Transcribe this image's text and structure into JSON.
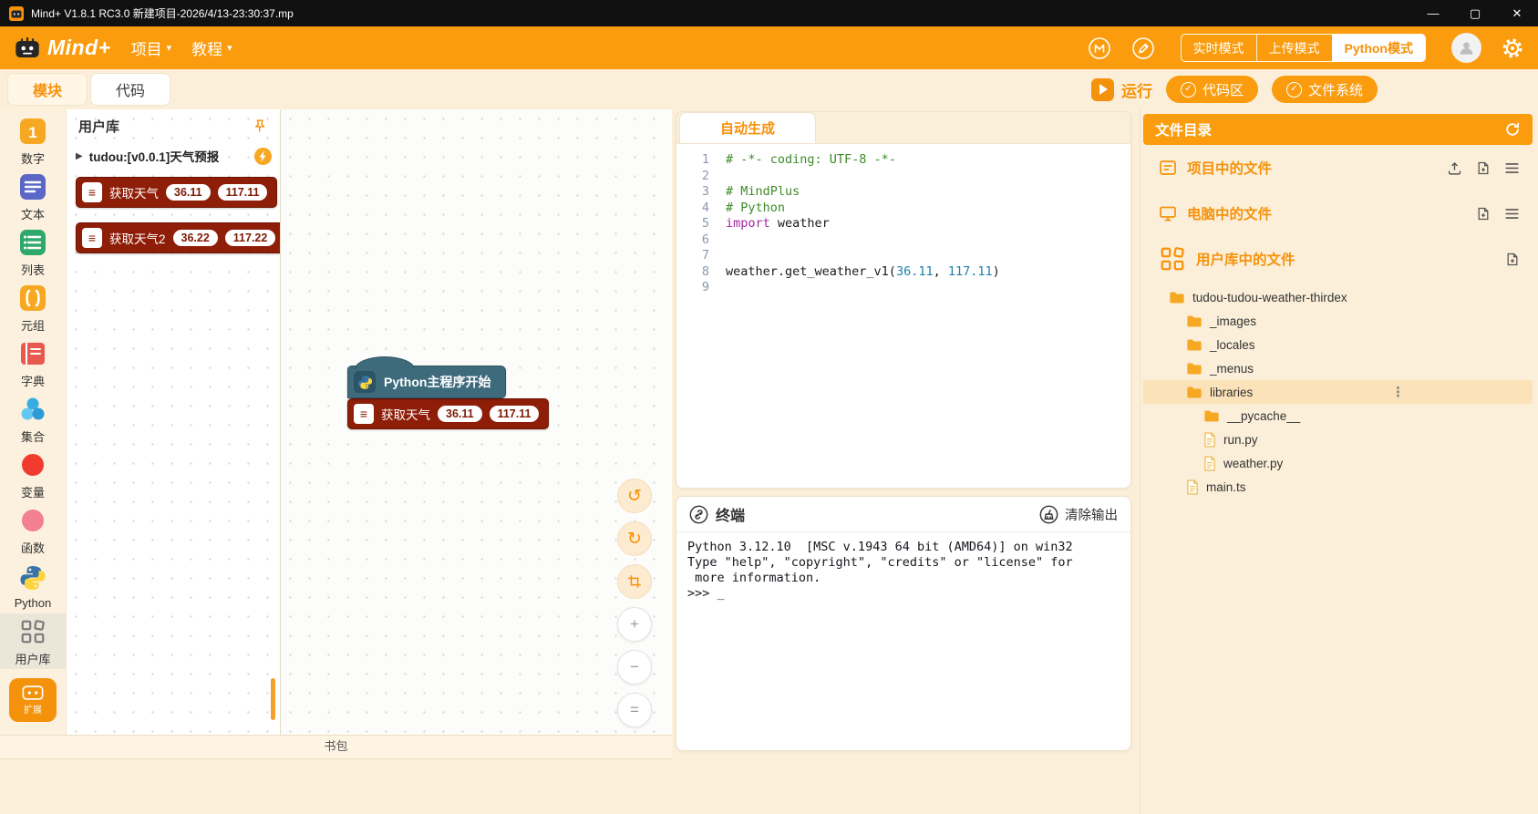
{
  "colors": {
    "accent": "#FA9C0D",
    "accent_text": "#F5920B",
    "block_red": "#8E1E08",
    "hat_blue": "#3E6B7C"
  },
  "titlebar": {
    "title": "Mind+ V1.8.1 RC3.0  新建项目-2026/4/13-23:30:37.mp",
    "minimize": "—",
    "maximize": "▢",
    "close": "✕"
  },
  "header": {
    "logo_text": "Mind+",
    "menus": [
      {
        "label": "项目"
      },
      {
        "label": "教程"
      }
    ],
    "modes": {
      "items": [
        "实时模式",
        "上传模式",
        "Python模式"
      ],
      "active": "Python模式"
    }
  },
  "toolbar": {
    "tabs": [
      {
        "label": "模块",
        "active": true
      },
      {
        "label": "代码",
        "active": false
      }
    ],
    "run_label": "运行",
    "code_area_label": "代码区",
    "file_system_label": "文件系统"
  },
  "sidebar": {
    "items": [
      {
        "label": "数字",
        "icon": "num"
      },
      {
        "label": "文本",
        "icon": "text"
      },
      {
        "label": "列表",
        "icon": "list"
      },
      {
        "label": "元组",
        "icon": "tuple"
      },
      {
        "label": "字典",
        "icon": "dict"
      },
      {
        "label": "集合",
        "icon": "set"
      },
      {
        "label": "变量",
        "icon": "var"
      },
      {
        "label": "函数",
        "icon": "fn"
      },
      {
        "label": "Python",
        "icon": "python"
      },
      {
        "label": "用户库",
        "icon": "userlib",
        "active": true
      }
    ],
    "extension_label": "扩展"
  },
  "palette": {
    "title": "用户库",
    "group": {
      "label": "tudou:[v0.0.1]天气预报"
    },
    "blocks": [
      {
        "label": "获取天气",
        "args": [
          "36.11",
          "117.11"
        ]
      },
      {
        "label": "获取天气2",
        "args": [
          "36.22",
          "117.22"
        ]
      }
    ]
  },
  "canvas": {
    "hat_label": "Python主程序开始",
    "blocks": [
      {
        "label": "获取天气",
        "args": [
          "36.11",
          "117.11"
        ]
      }
    ],
    "backpack_label": "书包"
  },
  "code": {
    "tab": "自动生成",
    "lines": [
      [
        {
          "t": "# -*- coding: UTF-8 -*-",
          "c": "comment"
        }
      ],
      [],
      [
        {
          "t": "# MindPlus",
          "c": "comment"
        }
      ],
      [
        {
          "t": "# Python",
          "c": "comment"
        }
      ],
      [
        {
          "t": "import",
          "c": "keyword"
        },
        {
          "t": " weather",
          "c": "plain"
        }
      ],
      [],
      [],
      [
        {
          "t": "weather.get_weather_v1(",
          "c": "plain"
        },
        {
          "t": "36.11",
          "c": "number"
        },
        {
          "t": ", ",
          "c": "plain"
        },
        {
          "t": "117.11",
          "c": "number"
        },
        {
          "t": ")",
          "c": "plain"
        }
      ],
      []
    ]
  },
  "terminal": {
    "title": "终端",
    "clear_label": "清除输出",
    "lines": [
      "Python 3.12.10  [MSC v.1943 64 bit (AMD64)] on win32",
      "Type \"help\", \"copyright\", \"credits\" or \"license\" for",
      " more information.",
      ">>> _"
    ]
  },
  "files": {
    "title": "文件目录",
    "sections": [
      {
        "label": "项目中的文件",
        "icon": "project",
        "actions": [
          "upload",
          "newfile",
          "menu"
        ]
      },
      {
        "label": "电脑中的文件",
        "icon": "computer",
        "actions": [
          "newfile",
          "menu"
        ]
      },
      {
        "label": "用户库中的文件",
        "icon": "userlib",
        "actions": [
          "newfile"
        ]
      }
    ],
    "tree": [
      {
        "label": "tudou-tudou-weather-thirdex",
        "level": 0,
        "kind": "folder"
      },
      {
        "label": "_images",
        "level": 1,
        "kind": "folder"
      },
      {
        "label": "_locales",
        "level": 1,
        "kind": "folder"
      },
      {
        "label": "_menus",
        "level": 1,
        "kind": "folder"
      },
      {
        "label": "libraries",
        "level": 1,
        "kind": "folder",
        "selected": true
      },
      {
        "label": "__pycache__",
        "level": 2,
        "kind": "folder"
      },
      {
        "label": "run.py",
        "level": 2,
        "kind": "file"
      },
      {
        "label": "weather.py",
        "level": 2,
        "kind": "file"
      },
      {
        "label": "main.ts",
        "level": 1,
        "kind": "file"
      }
    ]
  }
}
